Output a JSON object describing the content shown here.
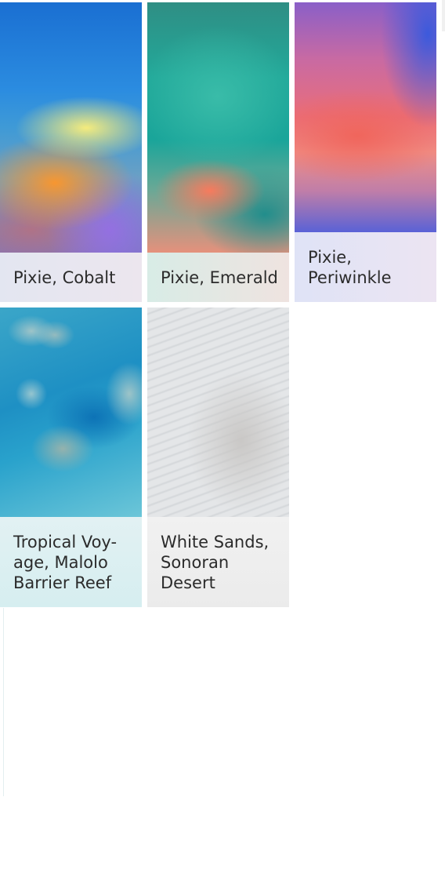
{
  "wallpapers": [
    {
      "lines": [
        "Pixie, Cobalt"
      ]
    },
    {
      "lines": [
        "Pixie, Emerald"
      ]
    },
    {
      "lines": [
        "Pixie,",
        "Periwinkle"
      ]
    },
    {
      "lines": [
        "Tropical Voy-",
        "age, Malolo",
        "Barrier Reef"
      ]
    },
    {
      "lines": [
        "White Sands,",
        "Sonoran",
        "Desert"
      ]
    }
  ]
}
